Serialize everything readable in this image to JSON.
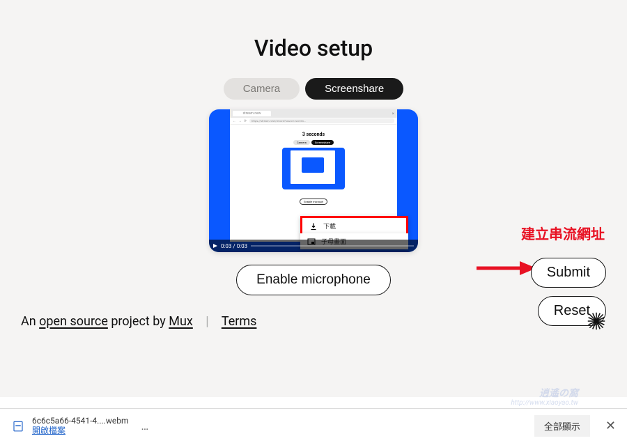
{
  "title": "Video setup",
  "tabs": {
    "camera": "Camera",
    "screenshare": "Screenshare"
  },
  "preview": {
    "inner_tab_label": "×",
    "inner_url": "https://stream.new/record?source=screen...",
    "countdown": "3 seconds",
    "inner_tabs": {
      "camera": "Camera",
      "screenshare": "Screenshare"
    },
    "inner_mic": "Enable microph",
    "time": "0:03 / 0:03",
    "ctx_download": "下載",
    "ctx_pip": "子母畫面"
  },
  "enable_mic": "Enable microphone",
  "annotation": "建立串流網址",
  "buttons": {
    "submit": "Submit",
    "reset": "Reset"
  },
  "footer": {
    "prefix": "An ",
    "open_source": "open source",
    "mid": " project by ",
    "mux": "Mux",
    "terms": "Terms"
  },
  "download_bar": {
    "filename": "6c6c5a66-4541-4....webm",
    "open_file": "開啟檔案",
    "show_all": "全部顯示"
  },
  "watermark": {
    "line1": "逍遙の窩",
    "line2": "http://www.xiaoyao.tw"
  }
}
